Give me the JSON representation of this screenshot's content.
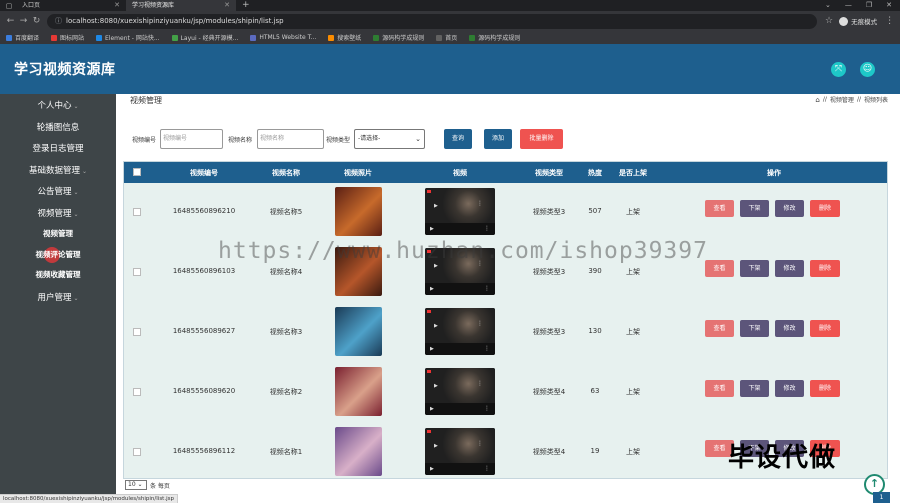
{
  "browser": {
    "tabs": [
      {
        "label": "入口页",
        "active": false
      },
      {
        "label": "学习视频资源库",
        "active": true
      }
    ],
    "new_tab": "+",
    "url": "localhost:8080/xuexishipinziyuanku/jsp/modules/shipin/list.jsp",
    "profile_label": "无痕模式",
    "bookmarks": [
      "百度翻译",
      "图标网站",
      "Element - 网站快...",
      "Layui - 经典开源模...",
      "HTML5 Website T...",
      "搜索壁纸",
      "源码构学成规则",
      "首页",
      "源码构学成规则"
    ],
    "bookmark_colors": [
      "#3b7ddd",
      "#e53935",
      "#1e88e5",
      "#43a047",
      "#5c6bc0",
      "#fb8c00",
      "#2e7d32",
      "#616161",
      "#2e7d32"
    ],
    "status_url": "localhost:8080/xuexishipinziyuanku/jsp/modules/shipin/list.jsp"
  },
  "app": {
    "title": "学习视频资源库",
    "header_icons": [
      "fullscreen-icon",
      "user-icon"
    ]
  },
  "sidebar": {
    "items": [
      {
        "label": "个人中心",
        "arrow": true,
        "sub": false
      },
      {
        "label": "轮播图信息",
        "arrow": false,
        "sub": false
      },
      {
        "label": "登录日志管理",
        "arrow": false,
        "sub": false
      },
      {
        "label": "基础数据管理",
        "arrow": true,
        "sub": false
      },
      {
        "label": "公告管理",
        "arrow": true,
        "sub": false
      },
      {
        "label": "视频管理",
        "arrow": true,
        "sub": false
      },
      {
        "label": "视频管理",
        "arrow": false,
        "sub": true
      },
      {
        "label": "视频评论管理",
        "arrow": false,
        "sub": true
      },
      {
        "label": "视频收藏管理",
        "arrow": false,
        "sub": true
      },
      {
        "label": "用户管理",
        "arrow": true,
        "sub": false
      }
    ]
  },
  "page": {
    "title": "视频管理",
    "breadcrumb": [
      "视频管理",
      "视频列表"
    ]
  },
  "search": {
    "code_label": "视频编号",
    "code_placeholder": "视频编号",
    "name_label": "视频名称",
    "name_placeholder": "视频名称",
    "type_label": "视频类型",
    "type_value": "-请选择-",
    "query_btn": "查询",
    "add_btn": "添加",
    "batch_delete_btn": "批量删除"
  },
  "table": {
    "headers": [
      "视频编号",
      "视频名称",
      "视频照片",
      "视频",
      "视频类型",
      "热度",
      "是否上架",
      "操作"
    ],
    "rows": [
      {
        "code": "16485560896210",
        "name": "视频名称5",
        "type": "视频类型3",
        "heat": "507",
        "status": "上架",
        "thumb_colors": [
          "#5a1f14",
          "#c76a2b"
        ]
      },
      {
        "code": "16485560896103",
        "name": "视频名称4",
        "type": "视频类型3",
        "heat": "390",
        "status": "上架",
        "thumb_colors": [
          "#3a1a10",
          "#b5562a"
        ]
      },
      {
        "code": "16485556089627",
        "name": "视频名称3",
        "type": "视频类型3",
        "heat": "130",
        "status": "上架",
        "thumb_colors": [
          "#1a3a55",
          "#4ea1c9"
        ]
      },
      {
        "code": "16485556089620",
        "name": "视频名称2",
        "type": "视频类型4",
        "heat": "63",
        "status": "上架",
        "thumb_colors": [
          "#7a2030",
          "#d9a08a"
        ]
      },
      {
        "code": "16485556896112",
        "name": "视频名称1",
        "type": "视频类型4",
        "heat": "19",
        "status": "上架",
        "thumb_colors": [
          "#6a4a8a",
          "#d8b0c8"
        ]
      }
    ],
    "actions": {
      "view": "查看",
      "down": "下架",
      "edit": "修改",
      "delete": "删除"
    }
  },
  "pager": {
    "page_size": "10",
    "suffix": "条 每页"
  },
  "overlay": {
    "watermark": "https://www.huzhan.com/ishop39397",
    "promo": "毕设代做"
  },
  "corner_badge": "1",
  "colors": {
    "header": "#1e5f8e",
    "sidebar": "#3e4548",
    "danger": "#ef5350",
    "view": "#e57373",
    "neutral_btn": "#5c557a"
  }
}
